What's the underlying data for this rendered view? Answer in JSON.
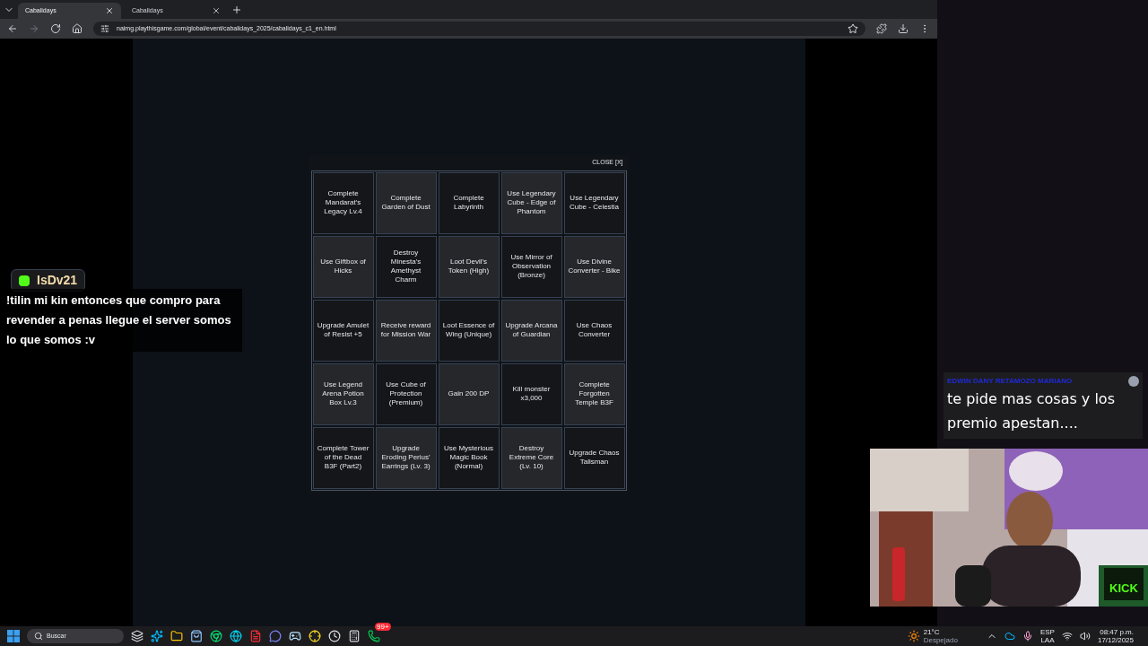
{
  "browser": {
    "tabs": [
      {
        "title": "Cabalidays",
        "selected": true
      },
      {
        "title": "Cabalidays",
        "selected": false
      }
    ],
    "url": "naimg.playthisgame.com/global/event/cabalidays_2025/cabalidays_c1_en.html"
  },
  "modal": {
    "close": "CLOSE [X]",
    "cells": [
      "Complete Mandarat's Legacy Lv.4",
      "Complete Garden of Dust",
      "Complete Labyrinth",
      "Use Legendary Cube - Edge of Phantom",
      "Use Legendary Cube - Celestia",
      "Use Giftbox of Hicks",
      "Destroy Minesta's Amethyst Charm",
      "Loot Devil's Token (High)",
      "Use Mirror of Observation (Bronze)",
      "Use Divine Converter - Bike",
      "Upgrade Amulet of Resist +5",
      "Receive reward for Mission War",
      "Loot Essence of Wing (Unique)",
      "Upgrade Arcana of Guardian",
      "Use Chaos Converter",
      "Use Legend Arena Potion Box Lv.3",
      "Use Cube of Protection (Premium)",
      "Gain 200 DP",
      "Kill monster x3,000",
      "Complete Forgotten Temple B3F",
      "Complete Tower of the Dead B3F (Part2)",
      "Upgrade Eroding Perius' Earrings (Lv. 3)",
      "Use Mysterious Magic Book (Normal)",
      "Destroy Extreme Core (Lv. 10)",
      "Upgrade Chaos Talisman"
    ]
  },
  "chat_left": {
    "user": "IsDv21",
    "message": "!tilin mi kin entonces que compro para revender a penas llegue el server somos lo que somos :v"
  },
  "chat_right": {
    "user": "EDWIN DANY RETAMOZO MARIANO",
    "message": "te pide mas cosas y los premio apestan...."
  },
  "stream_logo": "KICK",
  "taskbar": {
    "search": "Buscar",
    "apps": [
      {
        "kind": "taskview"
      },
      {
        "kind": "copilot"
      },
      {
        "kind": "files"
      },
      {
        "kind": "store"
      },
      {
        "kind": "chrome"
      },
      {
        "kind": "edge"
      },
      {
        "kind": "wps"
      },
      {
        "kind": "discord"
      },
      {
        "kind": "steam"
      },
      {
        "kind": "target"
      },
      {
        "kind": "clock"
      },
      {
        "kind": "calculator"
      },
      {
        "kind": "whatsapp",
        "badge": "99+"
      }
    ],
    "weather": {
      "temp": "21°C",
      "condition": "Despejado"
    },
    "language": [
      "ESP",
      "LAA"
    ],
    "time": "08:47 p.m.",
    "date": "17/12/2025"
  }
}
